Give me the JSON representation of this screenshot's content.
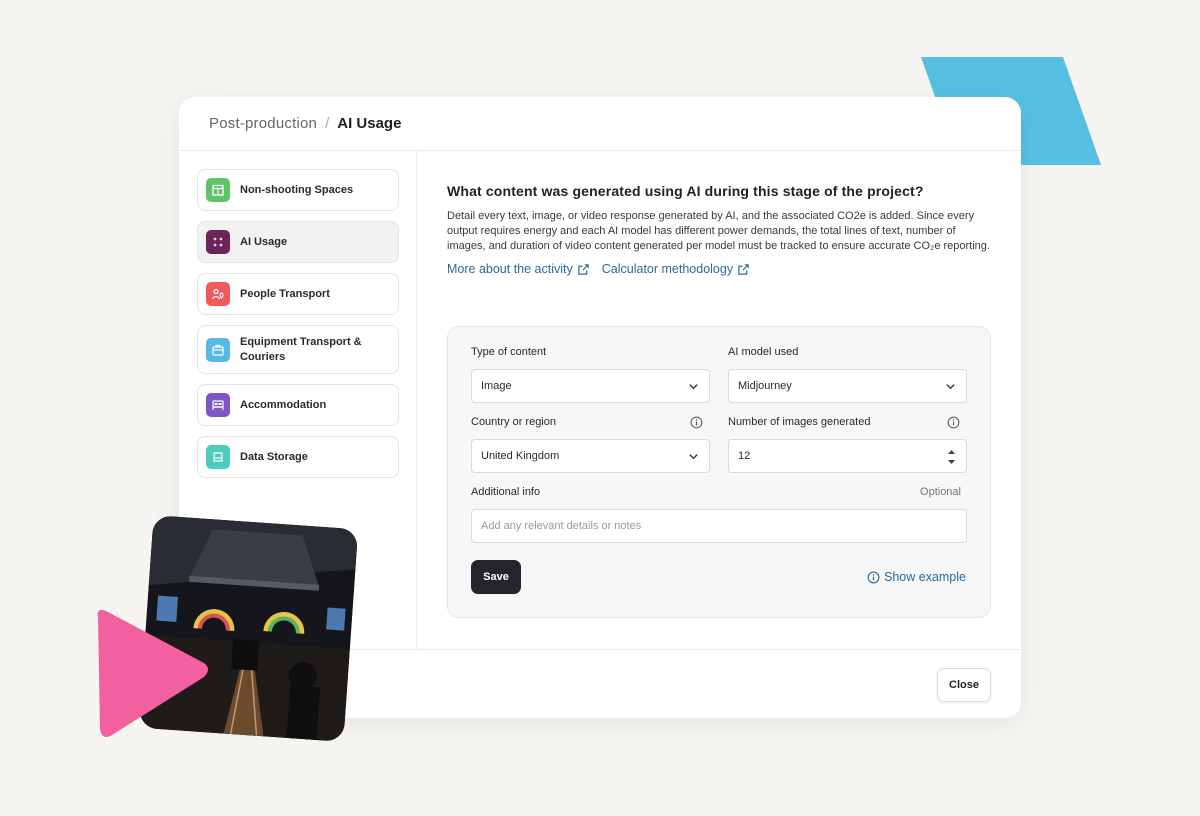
{
  "breadcrumb": {
    "parent": "Post-production",
    "separator": "/",
    "current": "AI Usage"
  },
  "sidebar": {
    "items": [
      {
        "label": "Non-shooting Spaces",
        "icon": "building-icon",
        "color": "#5fc468",
        "active": false
      },
      {
        "label": "AI Usage",
        "icon": "sparkles-icon",
        "color": "#6c2559",
        "active": true
      },
      {
        "label": "People Transport",
        "icon": "people-pin-icon",
        "color": "#ef5b5b",
        "active": false
      },
      {
        "label": "Equipment Transport & Couriers",
        "icon": "package-icon",
        "color": "#57b7e6",
        "active": false
      },
      {
        "label": "Accommodation",
        "icon": "bed-icon",
        "color": "#7d55c7",
        "active": false
      },
      {
        "label": "Data Storage",
        "icon": "storage-icon",
        "color": "#4ecbbb",
        "active": false
      }
    ]
  },
  "main": {
    "question": "What content was generated using AI during this stage of the project?",
    "description": "Detail every text, image, or video response generated by AI, and the associated CO2e is added. Since every output requires energy and each AI model has different power demands, the total lines of text, number of images, and duration of video content generated per model must be tracked to ensure accurate CO₂e reporting.",
    "link_activity": "More about the activity",
    "link_methodology": "Calculator methodology"
  },
  "form": {
    "type_label": "Type of content",
    "type_value": "Image",
    "model_label": "AI model used",
    "model_value": "Midjourney",
    "country_label": "Country or region",
    "country_value": "United Kingdom",
    "count_label": "Number of images generated",
    "count_value": "12",
    "additional_label": "Additional info",
    "optional_label": "Optional",
    "additional_placeholder": "Add any relevant details or notes",
    "save_label": "Save",
    "show_example_label": "Show example"
  },
  "footer": {
    "close_label": "Close"
  },
  "colors": {
    "accent_link": "#2c6a9c",
    "deco_blue": "#57c0e2",
    "deco_pink": "#f2609f",
    "button_dark": "#23252a"
  }
}
